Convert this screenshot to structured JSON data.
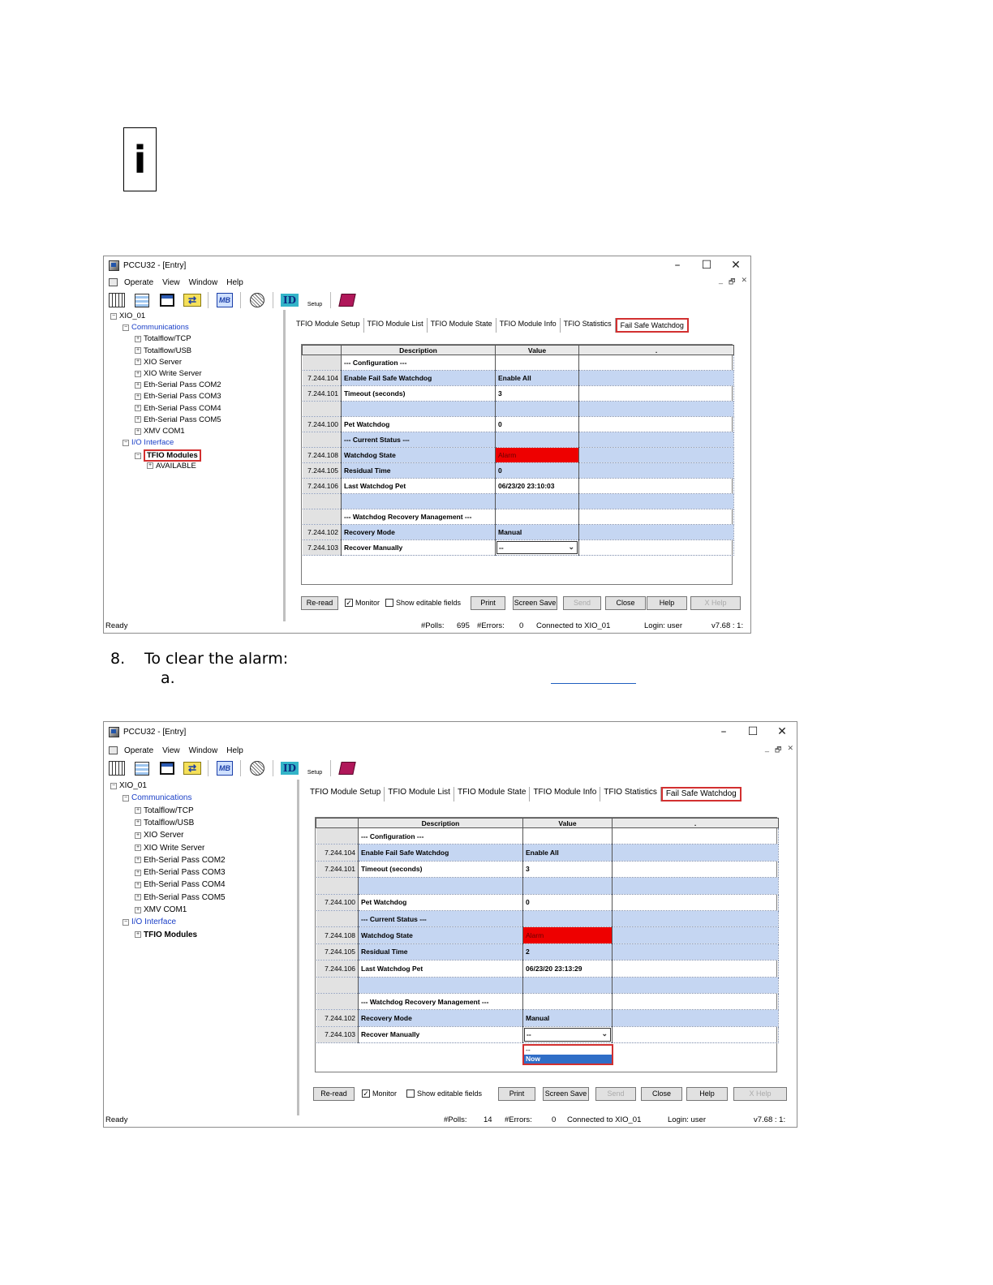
{
  "doc": {
    "info_icon": "info-icon",
    "step_number": "8.",
    "step_text": "To clear the alarm:",
    "substep_label": "a."
  },
  "screenshots": [
    {
      "title": "PCCU32 - [Entry]",
      "window_controls": [
        "–",
        "☐",
        "✕"
      ],
      "menu": [
        "Operate",
        "View",
        "Window",
        "Help"
      ],
      "mdi_controls": [
        "_",
        "🗗",
        "✕"
      ],
      "toolbar": {
        "setup_label": "Setup"
      },
      "tree": {
        "root": "XIO_01",
        "communications": "Communications",
        "comm_items": [
          "Totalflow/TCP",
          "Totalflow/USB",
          "XIO Server",
          "XIO Write Server",
          "Eth-Serial Pass COM2",
          "Eth-Serial Pass COM3",
          "Eth-Serial Pass COM4",
          "Eth-Serial Pass COM5",
          "XMV COM1"
        ],
        "io_interface": "I/O Interface",
        "tfio_modules": "TFIO Modules",
        "available": "AVAILABLE"
      },
      "tabs": [
        "TFIO Module Setup",
        "TFIO Module List",
        "TFIO Module State",
        "TFIO Module Info",
        "TFIO Statistics",
        "Fail Safe Watchdog"
      ],
      "grid": {
        "headers": [
          "",
          "Description",
          "Value",
          "."
        ],
        "rows": [
          {
            "reg": "",
            "desc": "--- Configuration ---",
            "val": "",
            "style": "plain"
          },
          {
            "reg": "7.244.104",
            "desc": "Enable Fail Safe Watchdog",
            "val": "Enable All",
            "style": "blue"
          },
          {
            "reg": "7.244.101",
            "desc": "Timeout (seconds)",
            "val": "3",
            "style": "plain"
          },
          {
            "reg": "",
            "desc": "",
            "val": "",
            "style": "blue"
          },
          {
            "reg": "7.244.100",
            "desc": "Pet Watchdog",
            "val": "0",
            "style": "plain"
          },
          {
            "reg": "",
            "desc": "--- Current Status ---",
            "val": "",
            "style": "blue"
          },
          {
            "reg": "7.244.108",
            "desc": "Watchdog State",
            "val": "Alarm",
            "style": "alarm"
          },
          {
            "reg": "7.244.105",
            "desc": "Residual Time",
            "val": "0",
            "style": "blue"
          },
          {
            "reg": "7.244.106",
            "desc": "Last Watchdog Pet",
            "val": "06/23/20 23:10:03",
            "style": "plain"
          },
          {
            "reg": "",
            "desc": "",
            "val": "",
            "style": "blue"
          },
          {
            "reg": "",
            "desc": "--- Watchdog Recovery Management ---",
            "val": "",
            "style": "plain"
          },
          {
            "reg": "7.244.102",
            "desc": "Recovery Mode",
            "val": "Manual",
            "style": "blue"
          },
          {
            "reg": "7.244.103",
            "desc": "Recover Manually",
            "val": "--",
            "style": "dropdown"
          }
        ]
      },
      "dropdown_open": false,
      "buttons": {
        "reread": "Re-read",
        "monitor": "Monitor",
        "monitor_checked": "✓",
        "show_editable": "Show editable fields",
        "print": "Print",
        "screen_save": "Screen Save",
        "send": "Send",
        "close": "Close",
        "help": "Help",
        "xhelp": "X Help"
      },
      "status": {
        "ready": "Ready",
        "polls_label": "#Polls:",
        "polls": "695",
        "errors_label": "#Errors:",
        "errors": "0",
        "connected": "Connected to XIO_01",
        "login": "Login: user",
        "version": "v7.68 : 1:"
      }
    },
    {
      "title": "PCCU32 - [Entry]",
      "window_controls": [
        "–",
        "☐",
        "✕"
      ],
      "menu": [
        "Operate",
        "View",
        "Window",
        "Help"
      ],
      "mdi_controls": [
        "_",
        "🗗",
        "✕"
      ],
      "toolbar": {
        "setup_label": "Setup"
      },
      "tree": {
        "root": "XIO_01",
        "communications": "Communications",
        "comm_items": [
          "Totalflow/TCP",
          "Totalflow/USB",
          "XIO Server",
          "XIO Write Server",
          "Eth-Serial Pass COM2",
          "Eth-Serial Pass COM3",
          "Eth-Serial Pass COM4",
          "Eth-Serial Pass COM5",
          "XMV COM1"
        ],
        "io_interface": "I/O Interface",
        "tfio_modules": "TFIO Modules",
        "available": ""
      },
      "tabs": [
        "TFIO Module Setup",
        "TFIO Module List",
        "TFIO Module State",
        "TFIO Module Info",
        "TFIO Statistics",
        "Fail Safe Watchdog"
      ],
      "grid": {
        "headers": [
          "",
          "Description",
          "Value",
          "."
        ],
        "rows": [
          {
            "reg": "",
            "desc": "--- Configuration ---",
            "val": "",
            "style": "plain"
          },
          {
            "reg": "7.244.104",
            "desc": "Enable Fail Safe Watchdog",
            "val": "Enable All",
            "style": "blue"
          },
          {
            "reg": "7.244.101",
            "desc": "Timeout (seconds)",
            "val": "3",
            "style": "plain"
          },
          {
            "reg": "",
            "desc": "",
            "val": "",
            "style": "blue"
          },
          {
            "reg": "7.244.100",
            "desc": "Pet Watchdog",
            "val": "0",
            "style": "plain"
          },
          {
            "reg": "",
            "desc": "--- Current Status ---",
            "val": "",
            "style": "blue"
          },
          {
            "reg": "7.244.108",
            "desc": "Watchdog State",
            "val": "Alarm",
            "style": "alarm"
          },
          {
            "reg": "7.244.105",
            "desc": "Residual Time",
            "val": "2",
            "style": "blue"
          },
          {
            "reg": "7.244.106",
            "desc": "Last Watchdog Pet",
            "val": "06/23/20 23:13:29",
            "style": "plain"
          },
          {
            "reg": "",
            "desc": "",
            "val": "",
            "style": "blue"
          },
          {
            "reg": "",
            "desc": "--- Watchdog Recovery Management ---",
            "val": "",
            "style": "plain"
          },
          {
            "reg": "7.244.102",
            "desc": "Recovery Mode",
            "val": "Manual",
            "style": "blue"
          },
          {
            "reg": "7.244.103",
            "desc": "Recover Manually",
            "val": "--",
            "style": "dropdown"
          }
        ]
      },
      "dropdown_open": true,
      "dropdown_options": [
        "--",
        "Now"
      ],
      "dropdown_selected": "Now",
      "buttons": {
        "reread": "Re-read",
        "monitor": "Monitor",
        "monitor_checked": "✓",
        "show_editable": "Show editable fields",
        "print": "Print",
        "screen_save": "Screen Save",
        "send": "Send",
        "close": "Close",
        "help": "Help",
        "xhelp": "X Help"
      },
      "status": {
        "ready": "Ready",
        "polls_label": "#Polls:",
        "polls": "14",
        "errors_label": "#Errors:",
        "errors": "0",
        "connected": "Connected to XIO_01",
        "login": "Login: user",
        "version": "v7.68 : 1:"
      }
    }
  ]
}
